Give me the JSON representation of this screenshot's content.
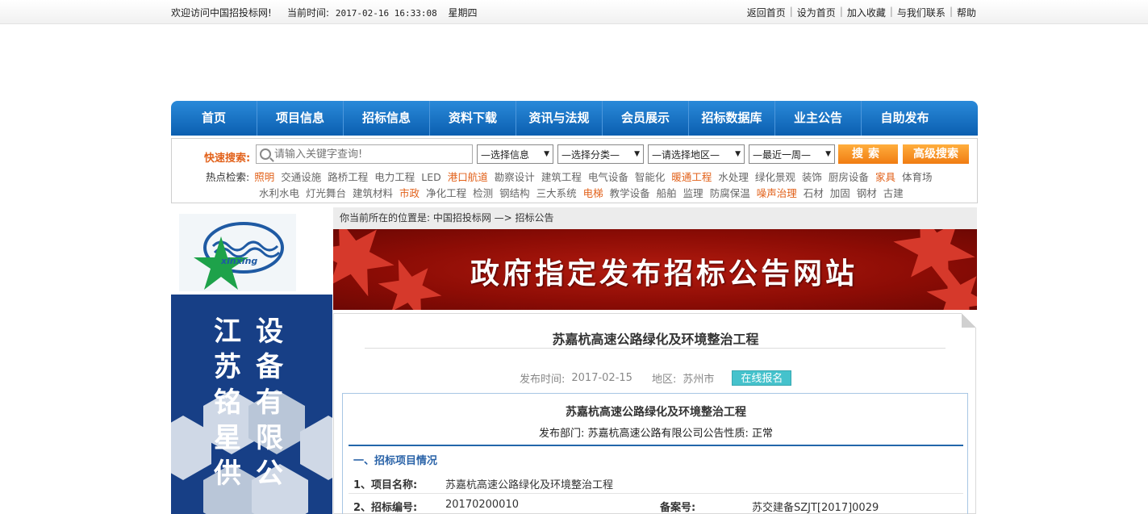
{
  "topbar": {
    "welcome": "欢迎访问中国招投标网!",
    "time_label": "当前时间:",
    "time_value": "2017-02-16 16:33:08",
    "weekday": "星期四",
    "links": [
      "返回首页",
      "设为首页",
      "加入收藏",
      "与我们联系",
      "帮助"
    ]
  },
  "nav": [
    "首页",
    "项目信息",
    "招标信息",
    "资料下载",
    "资讯与法规",
    "会员展示",
    "招标数据库",
    "业主公告",
    "自助发布"
  ],
  "search": {
    "label": "快速搜索:",
    "placeholder": "请输入关键字查询!",
    "selects": [
      "—选择信息",
      "—选择分类—",
      "—请选择地区—",
      "—最近一周—"
    ],
    "search_button": "搜索",
    "advanced_button": "高级搜索",
    "hot_label": "热点检索:",
    "hot_row1": [
      {
        "t": "照明",
        "o": true
      },
      {
        "t": "交通设施"
      },
      {
        "t": "路桥工程"
      },
      {
        "t": "电力工程"
      },
      {
        "t": "LED"
      },
      {
        "t": "港口航道",
        "o": true
      },
      {
        "t": "勘察设计"
      },
      {
        "t": "建筑工程"
      },
      {
        "t": "电气设备"
      },
      {
        "t": "智能化"
      },
      {
        "t": "暖通工程",
        "o": true
      },
      {
        "t": "水处理"
      },
      {
        "t": "绿化景观"
      },
      {
        "t": "装饰"
      },
      {
        "t": "厨房设备"
      },
      {
        "t": "家具",
        "o": true
      },
      {
        "t": "体育场"
      }
    ],
    "hot_row2": [
      {
        "t": "水利水电"
      },
      {
        "t": "灯光舞台"
      },
      {
        "t": "建筑材料"
      },
      {
        "t": "市政",
        "o": true
      },
      {
        "t": "净化工程"
      },
      {
        "t": "检测"
      },
      {
        "t": "钢结构"
      },
      {
        "t": "三大系统"
      },
      {
        "t": "电梯",
        "o": true
      },
      {
        "t": "教学设备"
      },
      {
        "t": "船舶"
      },
      {
        "t": "监理"
      },
      {
        "t": "防腐保温"
      },
      {
        "t": "噪声治理",
        "o": true
      },
      {
        "t": "石材"
      },
      {
        "t": "加固"
      },
      {
        "t": "钢材"
      },
      {
        "t": "古建"
      }
    ]
  },
  "sidebar": {
    "logo_text": "xinxing",
    "ad_col1": [
      "江",
      "苏",
      "铭",
      "星",
      "供"
    ],
    "ad_col2": [
      "设",
      "备",
      "有",
      "限",
      "公"
    ]
  },
  "breadcrumb": "你当前所在的位置是: 中国招投标网 —> 招标公告",
  "banner_text": "政府指定发布招标公告网站",
  "article": {
    "title": "苏嘉杭高速公路绿化及环境整治工程",
    "publish_label": "发布时间:",
    "publish_date": "2017-02-15",
    "region_label": "地区:",
    "region": "苏州市",
    "register_button": "在线报名",
    "detail_title": "苏嘉杭高速公路绿化及环境整治工程",
    "dept_line": "发布部门: 苏嘉杭高速公路有限公司公告性质: 正常",
    "section": "一、招标项目情况",
    "rows": [
      {
        "k": "1、项目名称:",
        "v": "苏嘉杭高速公路绿化及环境整治工程"
      },
      {
        "k": "2、招标编号:",
        "v": "20170200010",
        "k2": "备案号:",
        "v2": "苏交建备SZJT[2017]0029"
      }
    ]
  }
}
